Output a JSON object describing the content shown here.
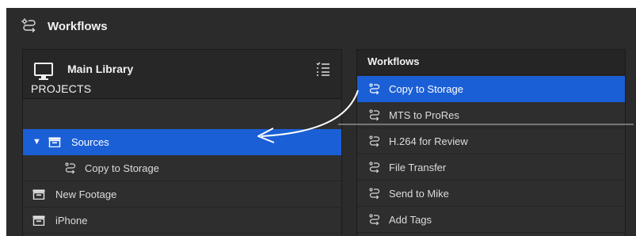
{
  "window": {
    "title": "Workflows",
    "title_icon": "workflow-icon"
  },
  "library": {
    "name": "Main Library",
    "icon": "monitor-icon",
    "list_icon": "list-settings-icon",
    "section_label": "PROJECTS",
    "items": [
      {
        "label": "Sources",
        "icon": "event-box-icon",
        "expanded": true,
        "selected": true
      },
      {
        "label": "Copy to Storage",
        "icon": "workflow-icon",
        "child": true
      },
      {
        "label": "New Footage",
        "icon": "event-box-icon"
      },
      {
        "label": "iPhone",
        "icon": "event-box-icon"
      }
    ]
  },
  "workflows": {
    "header": "Workflows",
    "items": [
      {
        "label": "Copy to Storage",
        "selected": true
      },
      {
        "label": "MTS to ProRes"
      },
      {
        "label": "H.264 for Review"
      },
      {
        "label": "File Transfer"
      },
      {
        "label": "Send to Mike"
      },
      {
        "label": "Add Tags"
      }
    ]
  },
  "colors": {
    "selection": "#1b5fd6",
    "background": "#2b2b2b",
    "arrow": "#ffffff"
  }
}
